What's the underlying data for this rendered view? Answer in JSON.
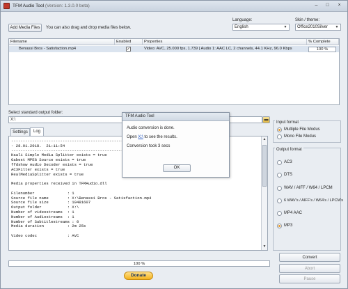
{
  "window": {
    "title": "TFM Audio Tool",
    "version": "(Version: 1.3.0.0 beta)",
    "controls": [
      "–",
      "□",
      "×"
    ]
  },
  "toolbar": {
    "add_media_label": "Add Media Files",
    "hint": "You can also drag and drop media files below."
  },
  "language": {
    "label": "Language:",
    "value": "English"
  },
  "skin": {
    "label": "Skin / theme:",
    "value": "Office2010Silver"
  },
  "grid": {
    "columns": [
      "Filename",
      "Enabled",
      "Properties",
      "% Complete"
    ],
    "rows": [
      {
        "filename": "Benassi Bros - Satisfaction.mp4",
        "enabled": "✓",
        "properties": "Video: AVC, 25.000 fps, 1.739 | Audio 1: AAC LC, 2 channels, 44.1 KHz, 96.0 Kbps",
        "complete": "100 %"
      }
    ]
  },
  "output_folder": {
    "label": "Select standard output folder:",
    "value": "X:\\"
  },
  "tabs": [
    "Settings",
    "Log"
  ],
  "log": {
    "text": "---------------------------------------------------------------------\n- 28.01.2018.  21:11:54\n---------------------------------------------------------------------\nHaali Simple Media Splitter exists = true\nGabest MPEG Source exists = true\nffdshow Audio Decoder exists = true\nAC3Filter exists = true\nRealMediaSplitter exists = true\n\nMedia properties received in TFMAudio.dll\n\nFilenumber              : 1\nSource file name        : X:\\Benassi Bros - Satisfaction.mp4\nSource file size        : 10481607\nOutput folder           : X:\\\nNumber of videostreams  : 1\nNumber of Audiostreams  : 1\nNumber of Subtitlestreams : 0\nMedia duration          : 2m 25s\n\nVideo codec             : AVC"
  },
  "input_format": {
    "title": "Input format",
    "options": [
      "Multiple File Modus",
      "Mono File Modus"
    ],
    "selected": 0
  },
  "output_format": {
    "title": "Output format",
    "options": [
      "AC3",
      "DTS",
      "WAV / AIFF / W64 / LPCM",
      "6 WAV's / AIFF's / W64's / LPCM's",
      "MP4 AAC",
      "MP3"
    ],
    "selected": 5
  },
  "progress": {
    "label": "100 %",
    "value": 1.0
  },
  "buttons": {
    "convert": "Convert",
    "abort": "Abort",
    "pause": "Pause",
    "donate": "Donate"
  },
  "dialog": {
    "title": "TFM Audio Tool",
    "line1": "Audio conversion is done.",
    "line2_pre": "Open",
    "line2_link": "X:\\",
    "line2_post": "to see the results.",
    "line3": "Conversion took 3 secs",
    "ok": "OK"
  },
  "colors": {
    "accent": "#e89a2c",
    "link": "#1a4fbf",
    "selected_row": "#dbe4ef"
  }
}
